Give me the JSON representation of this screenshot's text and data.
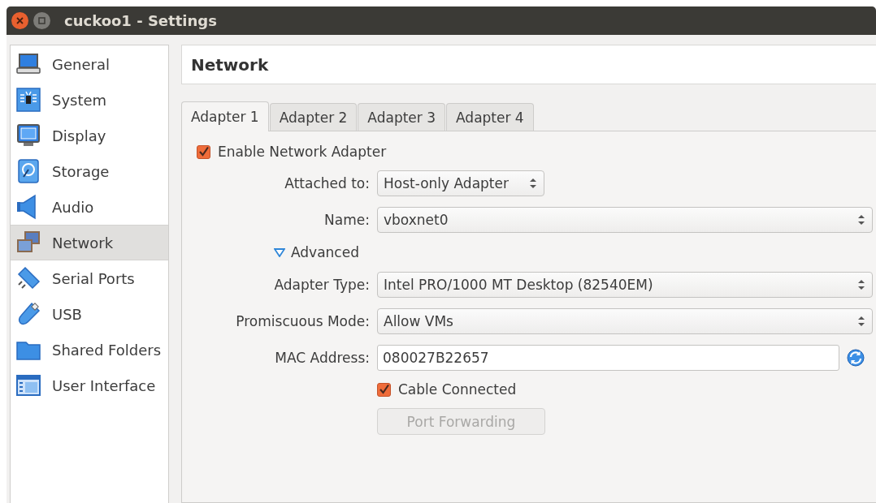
{
  "window": {
    "title": "cuckoo1 - Settings"
  },
  "sidebar": {
    "items": [
      {
        "label": "General",
        "selected": false
      },
      {
        "label": "System",
        "selected": false
      },
      {
        "label": "Display",
        "selected": false
      },
      {
        "label": "Storage",
        "selected": false
      },
      {
        "label": "Audio",
        "selected": false
      },
      {
        "label": "Network",
        "selected": true
      },
      {
        "label": "Serial Ports",
        "selected": false
      },
      {
        "label": "USB",
        "selected": false
      },
      {
        "label": "Shared Folders",
        "selected": false
      },
      {
        "label": "User Interface",
        "selected": false
      }
    ]
  },
  "page_title": "Network",
  "tabs": [
    {
      "label": "Adapter 1",
      "selected": true
    },
    {
      "label": "Adapter 2",
      "selected": false
    },
    {
      "label": "Adapter 3",
      "selected": false
    },
    {
      "label": "Adapter 4",
      "selected": false
    }
  ],
  "enable_adapter": {
    "label": "Enable Network Adapter",
    "checked": true
  },
  "basic_fields": [
    {
      "kind": "select",
      "label": "Attached to:",
      "value": "Host-only Adapter"
    },
    {
      "kind": "select",
      "label": "Name:",
      "value": "vboxnet0"
    }
  ],
  "advanced": {
    "label": "Advanced",
    "expanded": true
  },
  "advanced_fields": [
    {
      "kind": "select",
      "label": "Adapter Type:",
      "value": "Intel PRO/1000 MT Desktop (82540EM)"
    },
    {
      "kind": "select",
      "label": "Promiscuous Mode:",
      "value": "Allow VMs"
    },
    {
      "kind": "text",
      "label": "MAC Address:",
      "value": "080027B22657"
    }
  ],
  "cable_connected": {
    "label": "Cable Connected",
    "checked": true
  },
  "port_forwarding": {
    "label": "Port Forwarding",
    "disabled": true
  }
}
